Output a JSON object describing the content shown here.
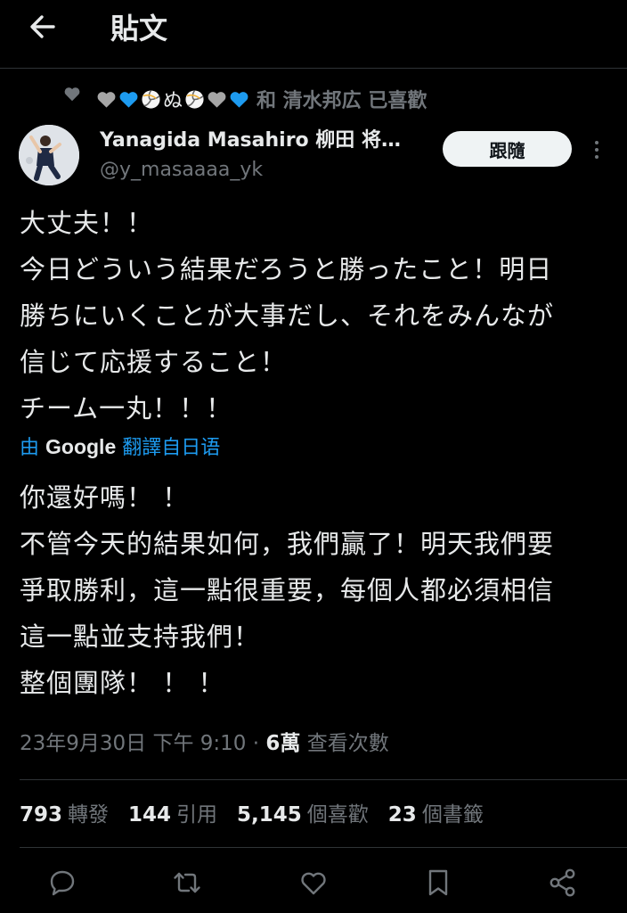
{
  "header": {
    "title": "貼文",
    "back_icon": "arrow-left-icon"
  },
  "social_context": {
    "emojis": [
      "grey-heart",
      "blue-heart",
      "volleyball",
      "nu",
      "volleyball",
      "grey-heart",
      "blue-heart"
    ],
    "nu_char": "ぬ",
    "text": "和 清水邦広 已喜歡"
  },
  "author": {
    "name": "Yanagida Masahiro 柳田 将…",
    "handle": "@y_masaaaa_yk",
    "follow_label": "跟隨"
  },
  "tweet": {
    "lines": [
      "大丈夫！！",
      "今日どういう結果だろうと勝ったこと！明日",
      "勝ちにいくことが大事だし、それをみんなが",
      "信じて応援すること！",
      "チーム一丸！！！"
    ]
  },
  "translation": {
    "prefix": "由",
    "provider": "Google",
    "suffix": "翻譯自日语",
    "lines": [
      "你還好嗎！ ！",
      "不管今天的結果如何，我們贏了！明天我們要",
      "爭取勝利，這一點很重要，每個人都必須相信",
      "這一點並支持我們！",
      "整個團隊！ ！ ！"
    ]
  },
  "meta": {
    "datetime": "23年9月30日 下午 9:10",
    "separator": "·",
    "views_count": "6萬",
    "views_label": "查看次數"
  },
  "stats": [
    {
      "count": "793",
      "label": "轉發"
    },
    {
      "count": "144",
      "label": "引用"
    },
    {
      "count": "5,145",
      "label": "個喜歡"
    },
    {
      "count": "23",
      "label": "個書籤"
    }
  ],
  "actions": [
    "reply-icon",
    "retweet-icon",
    "like-icon",
    "bookmark-icon",
    "share-icon"
  ],
  "colors": {
    "background": "#000000",
    "text": "#e7e9ea",
    "muted": "#71767b",
    "link": "#1d9bf0",
    "blue_heart": "#1d9bf0"
  }
}
